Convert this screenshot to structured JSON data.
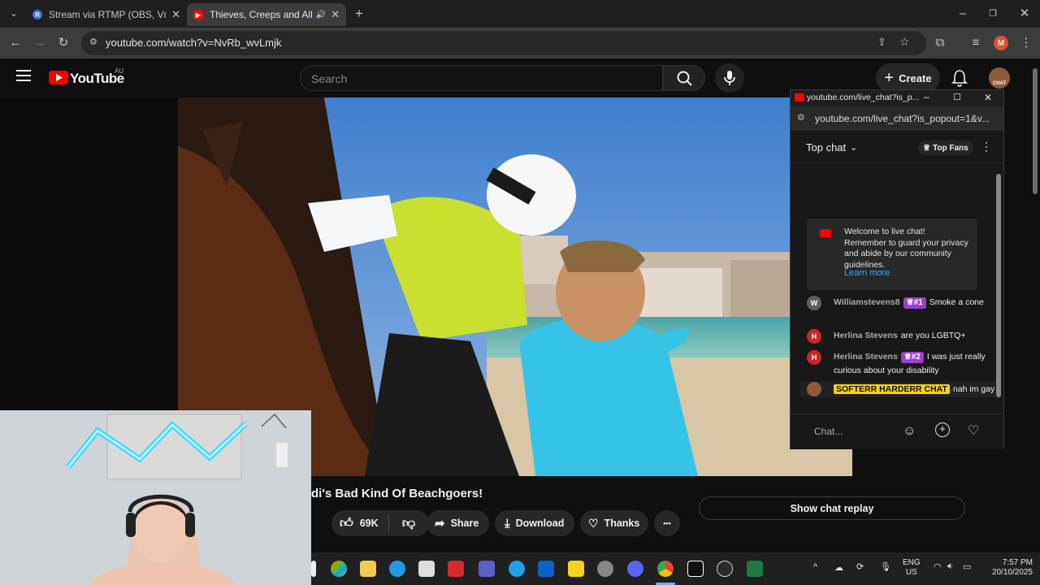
{
  "browser": {
    "tabs": [
      {
        "title": "Stream via RTMP (OBS, Vmix, Ze",
        "active": false,
        "favicon": "R"
      },
      {
        "title": "Thieves, Creeps and All In B",
        "active": true,
        "favicon": "youtube"
      }
    ],
    "url": "youtube.com/watch?v=NvRb_wvLmjk",
    "profile_initial": "M"
  },
  "youtube": {
    "logo_text": "YouTube",
    "region": "AU",
    "search_placeholder": "Search",
    "create_label": "Create",
    "avatar_text": "CHAT"
  },
  "video": {
    "title": "di's Bad Kind Of Beachgoers!",
    "likes": "69K",
    "share_label": "Share",
    "download_label": "Download",
    "thanks_label": "Thanks",
    "more_label": "•••"
  },
  "chat_popout": {
    "window_title": "youtube.com/live_chat?is_p...",
    "url": "youtube.com/live_chat?is_popout=1&v...",
    "mode_label": "Top chat",
    "top_fans_label": "Top Fans",
    "welcome_text": "Welcome to live chat! Remember to guard your privacy and abide by our community guidelines.",
    "learn_more": "Learn more",
    "messages": [
      {
        "initial": "W",
        "avatar_color": "#5f5f5f",
        "author": "Williamstevens8",
        "badge": "#1",
        "text": "Smoke a cone",
        "highlight": false
      },
      {
        "initial": "H",
        "avatar_color": "#c62828",
        "author": "Herlina Stevens",
        "badge": "",
        "text": "are you LGBTQ+",
        "highlight": false
      },
      {
        "initial": "H",
        "avatar_color": "#c62828",
        "author": "Herlina Stevens",
        "badge": "#2",
        "text": "I was just really curious about your disability",
        "highlight": false
      },
      {
        "initial": "",
        "avatar_color": "#8d5b3a",
        "author": "SOFTERR HARDERR CHAT",
        "badge": "",
        "text": "nah im gay",
        "highlight": true
      }
    ],
    "input_placeholder": "Chat..."
  },
  "show_chat_replay": "Show chat replay",
  "taskbar": {
    "lang_line1": "ENG",
    "lang_line2": "US",
    "time": "7:57 PM",
    "date": "20/10/2025"
  }
}
